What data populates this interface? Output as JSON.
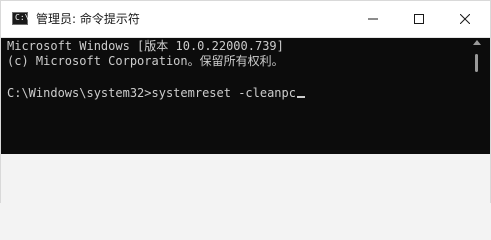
{
  "window": {
    "title": "管理员: 命令提示符",
    "icon": "cmd-icon",
    "controls": {
      "minimize_icon": "minimize-icon",
      "maximize_icon": "maximize-icon",
      "close_icon": "close-icon"
    }
  },
  "console": {
    "lines": [
      "Microsoft Windows [版本 10.0.22000.739]",
      "(c) Microsoft Corporation。保留所有权利。",
      "C:\\Windows\\system32>systemreset -cleanpc"
    ],
    "text_color": "#cccccc",
    "background": "#0c0c0c"
  }
}
